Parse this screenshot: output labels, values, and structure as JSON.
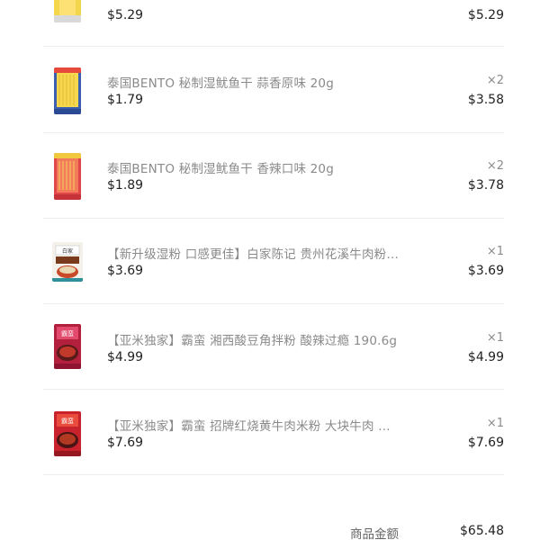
{
  "items": [
    {
      "title": "",
      "unit_price": "$5.29",
      "qty": "",
      "line_total": "$5.29",
      "thumb_color": "#f2d24a"
    },
    {
      "title": "泰国BENTO 秘制湿鱿鱼干 蒜香原味 20g",
      "unit_price": "$1.79",
      "qty": "×2",
      "line_total": "$3.58",
      "thumb_color": "#f3d64b"
    },
    {
      "title": "泰国BENTO 秘制湿鱿鱼干 香辣口味 20g",
      "unit_price": "$1.89",
      "qty": "×2",
      "line_total": "$3.78",
      "thumb_color": "#e54a4a"
    },
    {
      "title": "【新升级湿粉 口感更佳】白家陈记 贵州花溪牛肉粉…",
      "unit_price": "$3.69",
      "qty": "×1",
      "line_total": "$3.69",
      "thumb_color": "#f0efe8"
    },
    {
      "title": "【亚米独家】霸蛮 湘西酸豆角拌粉 酸辣过瘾 190.6g",
      "unit_price": "$4.99",
      "qty": "×1",
      "line_total": "$4.99",
      "thumb_color": "#b31f3b"
    },
    {
      "title": "【亚米独家】霸蛮 招牌红烧黄牛肉米粉 大块牛肉 …",
      "unit_price": "$7.69",
      "qty": "×1",
      "line_total": "$7.69",
      "thumb_color": "#c51f2a"
    }
  ],
  "summary": {
    "label": "商品金额",
    "value": "$65.48"
  }
}
